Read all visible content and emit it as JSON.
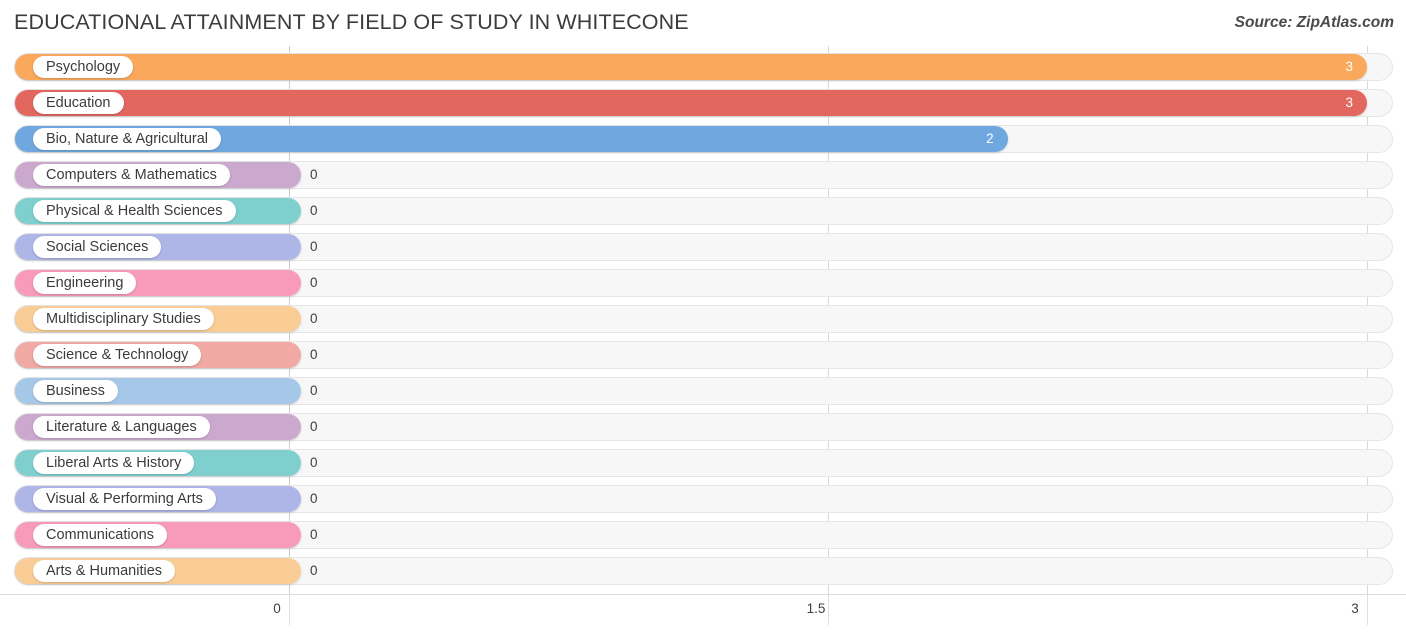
{
  "header": {
    "title": "EDUCATIONAL ATTAINMENT BY FIELD OF STUDY IN WHITECONE",
    "source": "Source: ZipAtlas.com"
  },
  "chart_data": {
    "type": "bar",
    "orientation": "horizontal",
    "title": "EDUCATIONAL ATTAINMENT BY FIELD OF STUDY IN WHITECONE",
    "xlabel": "",
    "ylabel": "",
    "xlim": [
      0,
      3
    ],
    "xticks": [
      "0",
      "1.5",
      "3"
    ],
    "xtick_values": [
      0,
      1.5,
      3
    ],
    "grid": true,
    "legend": "none",
    "categories": [
      "Psychology",
      "Education",
      "Bio, Nature & Agricultural",
      "Computers & Mathematics",
      "Physical & Health Sciences",
      "Social Sciences",
      "Engineering",
      "Multidisciplinary Studies",
      "Science & Technology",
      "Business",
      "Literature & Languages",
      "Liberal Arts & History",
      "Visual & Performing Arts",
      "Communications",
      "Arts & Humanities"
    ],
    "values": [
      3,
      3,
      2,
      0,
      0,
      0,
      0,
      0,
      0,
      0,
      0,
      0,
      0,
      0,
      0
    ],
    "value_labels": [
      "3",
      "3",
      "2",
      "0",
      "0",
      "0",
      "0",
      "0",
      "0",
      "0",
      "0",
      "0",
      "0",
      "0",
      "0"
    ],
    "colors": [
      "#F9A85C",
      "#E2675F",
      "#6FA8DF",
      "#CBA9CE",
      "#7FCFCF",
      "#AEB6E8",
      "#F89AB9",
      "#FBCD96",
      "#F0A9A4",
      "#A6C8E8",
      "#CBA9CE",
      "#7FCFCF",
      "#AEB6E8",
      "#F89AB9",
      "#FBCD96"
    ]
  }
}
